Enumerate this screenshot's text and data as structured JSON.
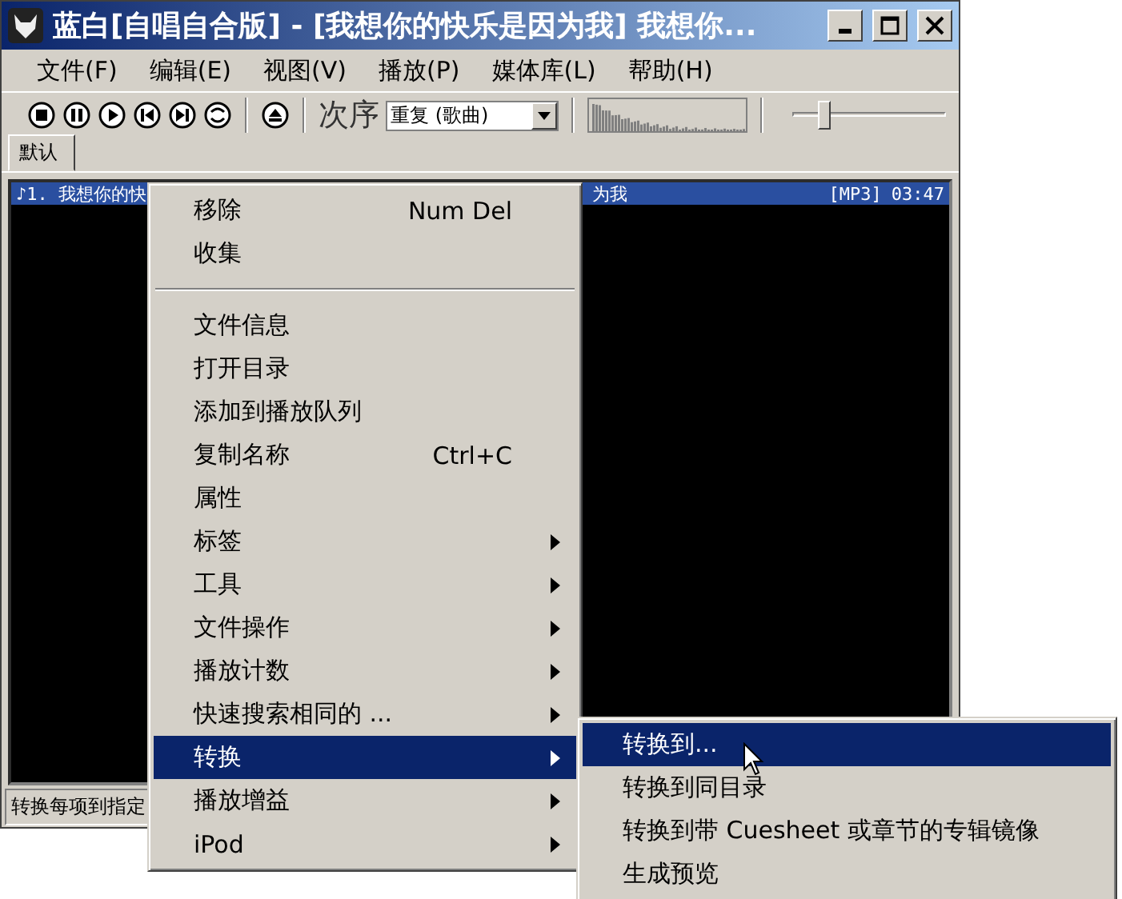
{
  "window": {
    "title": "蓝白[自唱自合版] - [我想你的快乐是因为我] 我想你..."
  },
  "menubar": [
    "文件(F)",
    "编辑(E)",
    "视图(V)",
    "播放(P)",
    "媒体库(L)",
    "帮助(H)"
  ],
  "toolbar": {
    "buttons": [
      {
        "kind": "stop"
      },
      {
        "kind": "pause"
      },
      {
        "kind": "play"
      },
      {
        "kind": "prev"
      },
      {
        "kind": "next"
      },
      {
        "kind": "random"
      },
      {
        "kind": "eject"
      }
    ],
    "order_label": "次序",
    "order_value": "重复 (歌曲)",
    "volume": {
      "level": 0.2
    }
  },
  "tabs": [
    {
      "label": "默认",
      "selected": true
    }
  ],
  "playlist": {
    "rows": [
      {
        "left": "♪1. 我想你的快",
        "right": "为我",
        "format": "[MP3]",
        "time": "03:47",
        "selected": true
      }
    ]
  },
  "status_bar": "转换每项到指定",
  "context_menu": {
    "items": [
      {
        "kind": "item",
        "label": "移除",
        "shortcut": "Num Del",
        "submenu": false,
        "selected": false
      },
      {
        "kind": "item",
        "label": "收集",
        "submenu": false,
        "selected": false
      },
      {
        "kind": "separator"
      },
      {
        "kind": "item",
        "label": "文件信息",
        "submenu": false,
        "selected": false
      },
      {
        "kind": "item",
        "label": "打开目录",
        "submenu": false,
        "selected": false
      },
      {
        "kind": "item",
        "label": "添加到播放队列",
        "submenu": false,
        "selected": false
      },
      {
        "kind": "item",
        "label": "复制名称",
        "shortcut": "Ctrl+C",
        "submenu": false,
        "selected": false
      },
      {
        "kind": "item",
        "label": "属性",
        "submenu": false,
        "selected": false
      },
      {
        "kind": "item",
        "label": "标签",
        "submenu": true,
        "selected": false
      },
      {
        "kind": "item",
        "label": "工具",
        "submenu": true,
        "selected": false
      },
      {
        "kind": "item",
        "label": "文件操作",
        "submenu": true,
        "selected": false
      },
      {
        "kind": "item",
        "label": "播放计数",
        "submenu": true,
        "selected": false
      },
      {
        "kind": "item",
        "label": "快速搜索相同的 ...",
        "submenu": true,
        "selected": false
      },
      {
        "kind": "item",
        "label": "转换",
        "submenu": true,
        "selected": true
      },
      {
        "kind": "item",
        "label": "播放增益",
        "submenu": true,
        "selected": false
      },
      {
        "kind": "item",
        "label": "iPod",
        "submenu": true,
        "selected": false
      }
    ]
  },
  "submenu": {
    "items": [
      {
        "label": "转换到...",
        "selected": true
      },
      {
        "label": "转换到同目录",
        "selected": false
      },
      {
        "label": "转换到带 Cuesheet 或章节的专辑镜像",
        "selected": false
      },
      {
        "label": "生成预览",
        "selected": false
      }
    ]
  }
}
